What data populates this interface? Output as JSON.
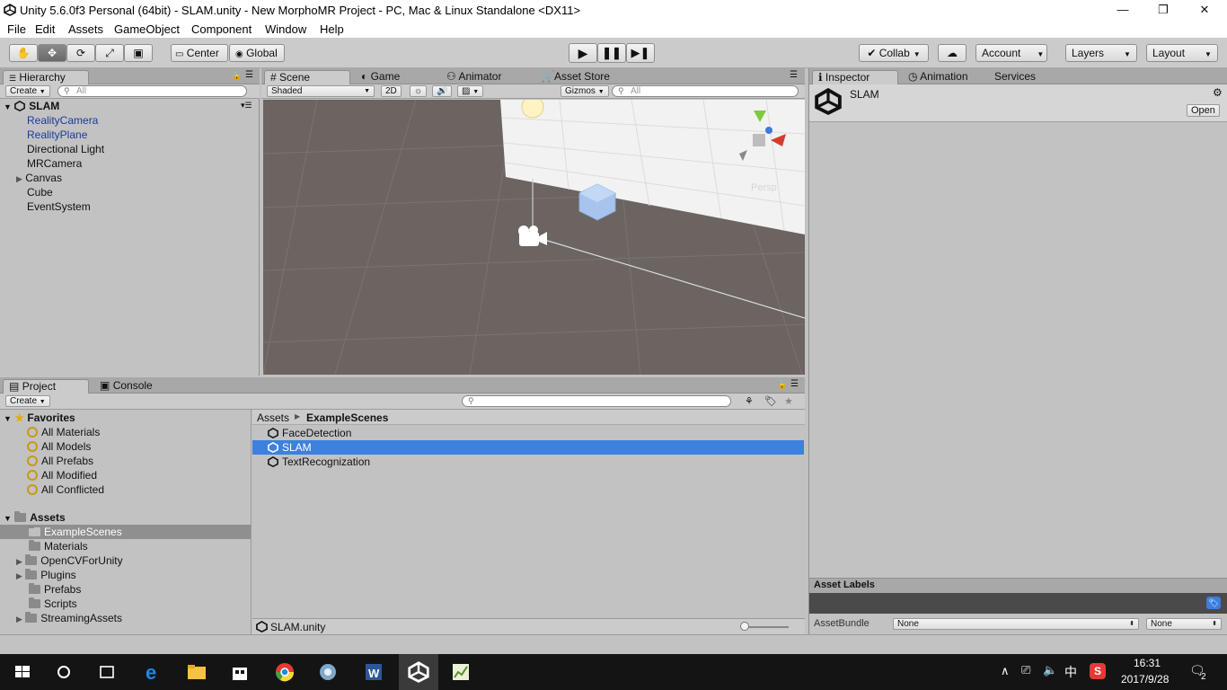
{
  "window": {
    "title": "Unity 5.6.0f3 Personal (64bit) - SLAM.unity - New MorphoMR Project - PC, Mac & Linux Standalone <DX11>",
    "controls": [
      "—",
      "❐",
      "✕"
    ]
  },
  "menu": [
    "File",
    "Edit",
    "Assets",
    "GameObject",
    "Component",
    "Window",
    "Help"
  ],
  "toolbar": {
    "pivot": "Center",
    "space": "Global",
    "collab": "Collab",
    "account": "Account",
    "layers": "Layers",
    "layout": "Layout"
  },
  "hierarchy": {
    "tab": "Hierarchy",
    "create": "Create",
    "search_placeholder": "All",
    "scene": "SLAM",
    "items": [
      {
        "label": "RealityCamera",
        "color": "#1a3c99"
      },
      {
        "label": "RealityPlane",
        "color": "#1a3c99"
      },
      {
        "label": "Directional Light",
        "color": "#111111"
      },
      {
        "label": "MRCamera",
        "color": "#111111"
      },
      {
        "label": "Canvas",
        "color": "#111111"
      },
      {
        "label": "Cube",
        "color": "#111111"
      },
      {
        "label": "EventSystem",
        "color": "#111111"
      }
    ]
  },
  "scene_view": {
    "tabs": [
      "Scene",
      "Game",
      "Animator",
      "Asset Store"
    ],
    "shading": "Shaded",
    "mode_2d": "2D",
    "gizmos": "Gizmos",
    "search_placeholder": "All",
    "persp": "Persp"
  },
  "inspector": {
    "tabs": [
      "Inspector",
      "Animation",
      "Services"
    ],
    "asset_name": "SLAM",
    "open_button": "Open",
    "asset_labels": "Asset Labels",
    "asset_bundle_label": "AssetBundle",
    "bundle_value": "None",
    "variant_value": "None"
  },
  "project": {
    "tabs": [
      "Project",
      "Console"
    ],
    "create": "Create",
    "favorites_header": "Favorites",
    "favorites": [
      "All Materials",
      "All Models",
      "All Prefabs",
      "All Modified",
      "All Conflicted"
    ],
    "assets_header": "Assets",
    "folders": [
      "ExampleScenes",
      "Materials",
      "OpenCVForUnity",
      "Plugins",
      "Prefabs",
      "Scripts",
      "StreamingAssets"
    ],
    "breadcrumb_root": "Assets",
    "breadcrumb_current": "ExampleScenes",
    "files": [
      "FaceDetection",
      "SLAM",
      "TextRecognization"
    ],
    "selected_file": "SLAM",
    "status_path": "SLAM.unity"
  },
  "taskbar": {
    "ime": "中",
    "time": "16:31",
    "date": "2017/9/28",
    "notifications": "2"
  },
  "colors": {
    "selection": "#3d80df",
    "scene_ground": "#6b6460"
  }
}
